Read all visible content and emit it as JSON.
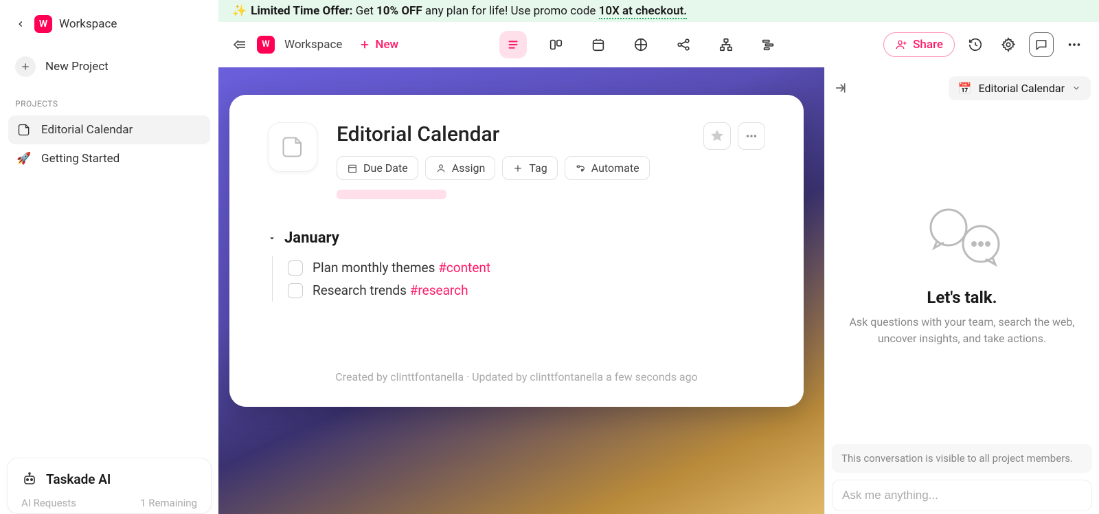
{
  "sidebar": {
    "workspace_letter": "W",
    "workspace_name": "Workspace",
    "new_project_label": "New Project",
    "projects_label": "PROJECTS",
    "projects": [
      {
        "name": "Editorial Calendar",
        "active": true,
        "icon": "doc"
      },
      {
        "name": "Getting Started",
        "active": false,
        "icon": "rocket"
      }
    ]
  },
  "ai_card": {
    "title": "Taskade AI",
    "requests_label": "AI Requests",
    "remaining_label": "1 Remaining"
  },
  "promo": {
    "sparkle": "✨",
    "lead_bold": "Limited Time Offer:",
    "mid_a": " Get ",
    "pct_bold": "10% OFF",
    "mid_b": " any plan for life! Use promo code ",
    "code": "10X at checkout."
  },
  "topbar": {
    "workspace_letter": "W",
    "breadcrumb": "Workspace",
    "new_label": "New",
    "share_label": "Share"
  },
  "doc": {
    "title": "Editorial Calendar",
    "pills": {
      "due_date": "Due Date",
      "assign": "Assign",
      "tag": "Tag",
      "automate": "Automate"
    },
    "groups": [
      {
        "title": "January",
        "tasks": [
          {
            "text": "Plan monthly themes ",
            "tag": "#content"
          },
          {
            "text": "Research trends ",
            "tag": "#research"
          }
        ]
      }
    ],
    "footer": "Created by clinttfontanella · Updated by clinttfontanella a few seconds ago"
  },
  "chat": {
    "context_icon": "📅",
    "context_label": "Editorial Calendar",
    "heading": "Let's talk.",
    "sub": "Ask questions with your team, search the web, uncover insights, and take actions.",
    "notice": "This conversation is visible to all project members.",
    "placeholder": "Ask me anything..."
  }
}
